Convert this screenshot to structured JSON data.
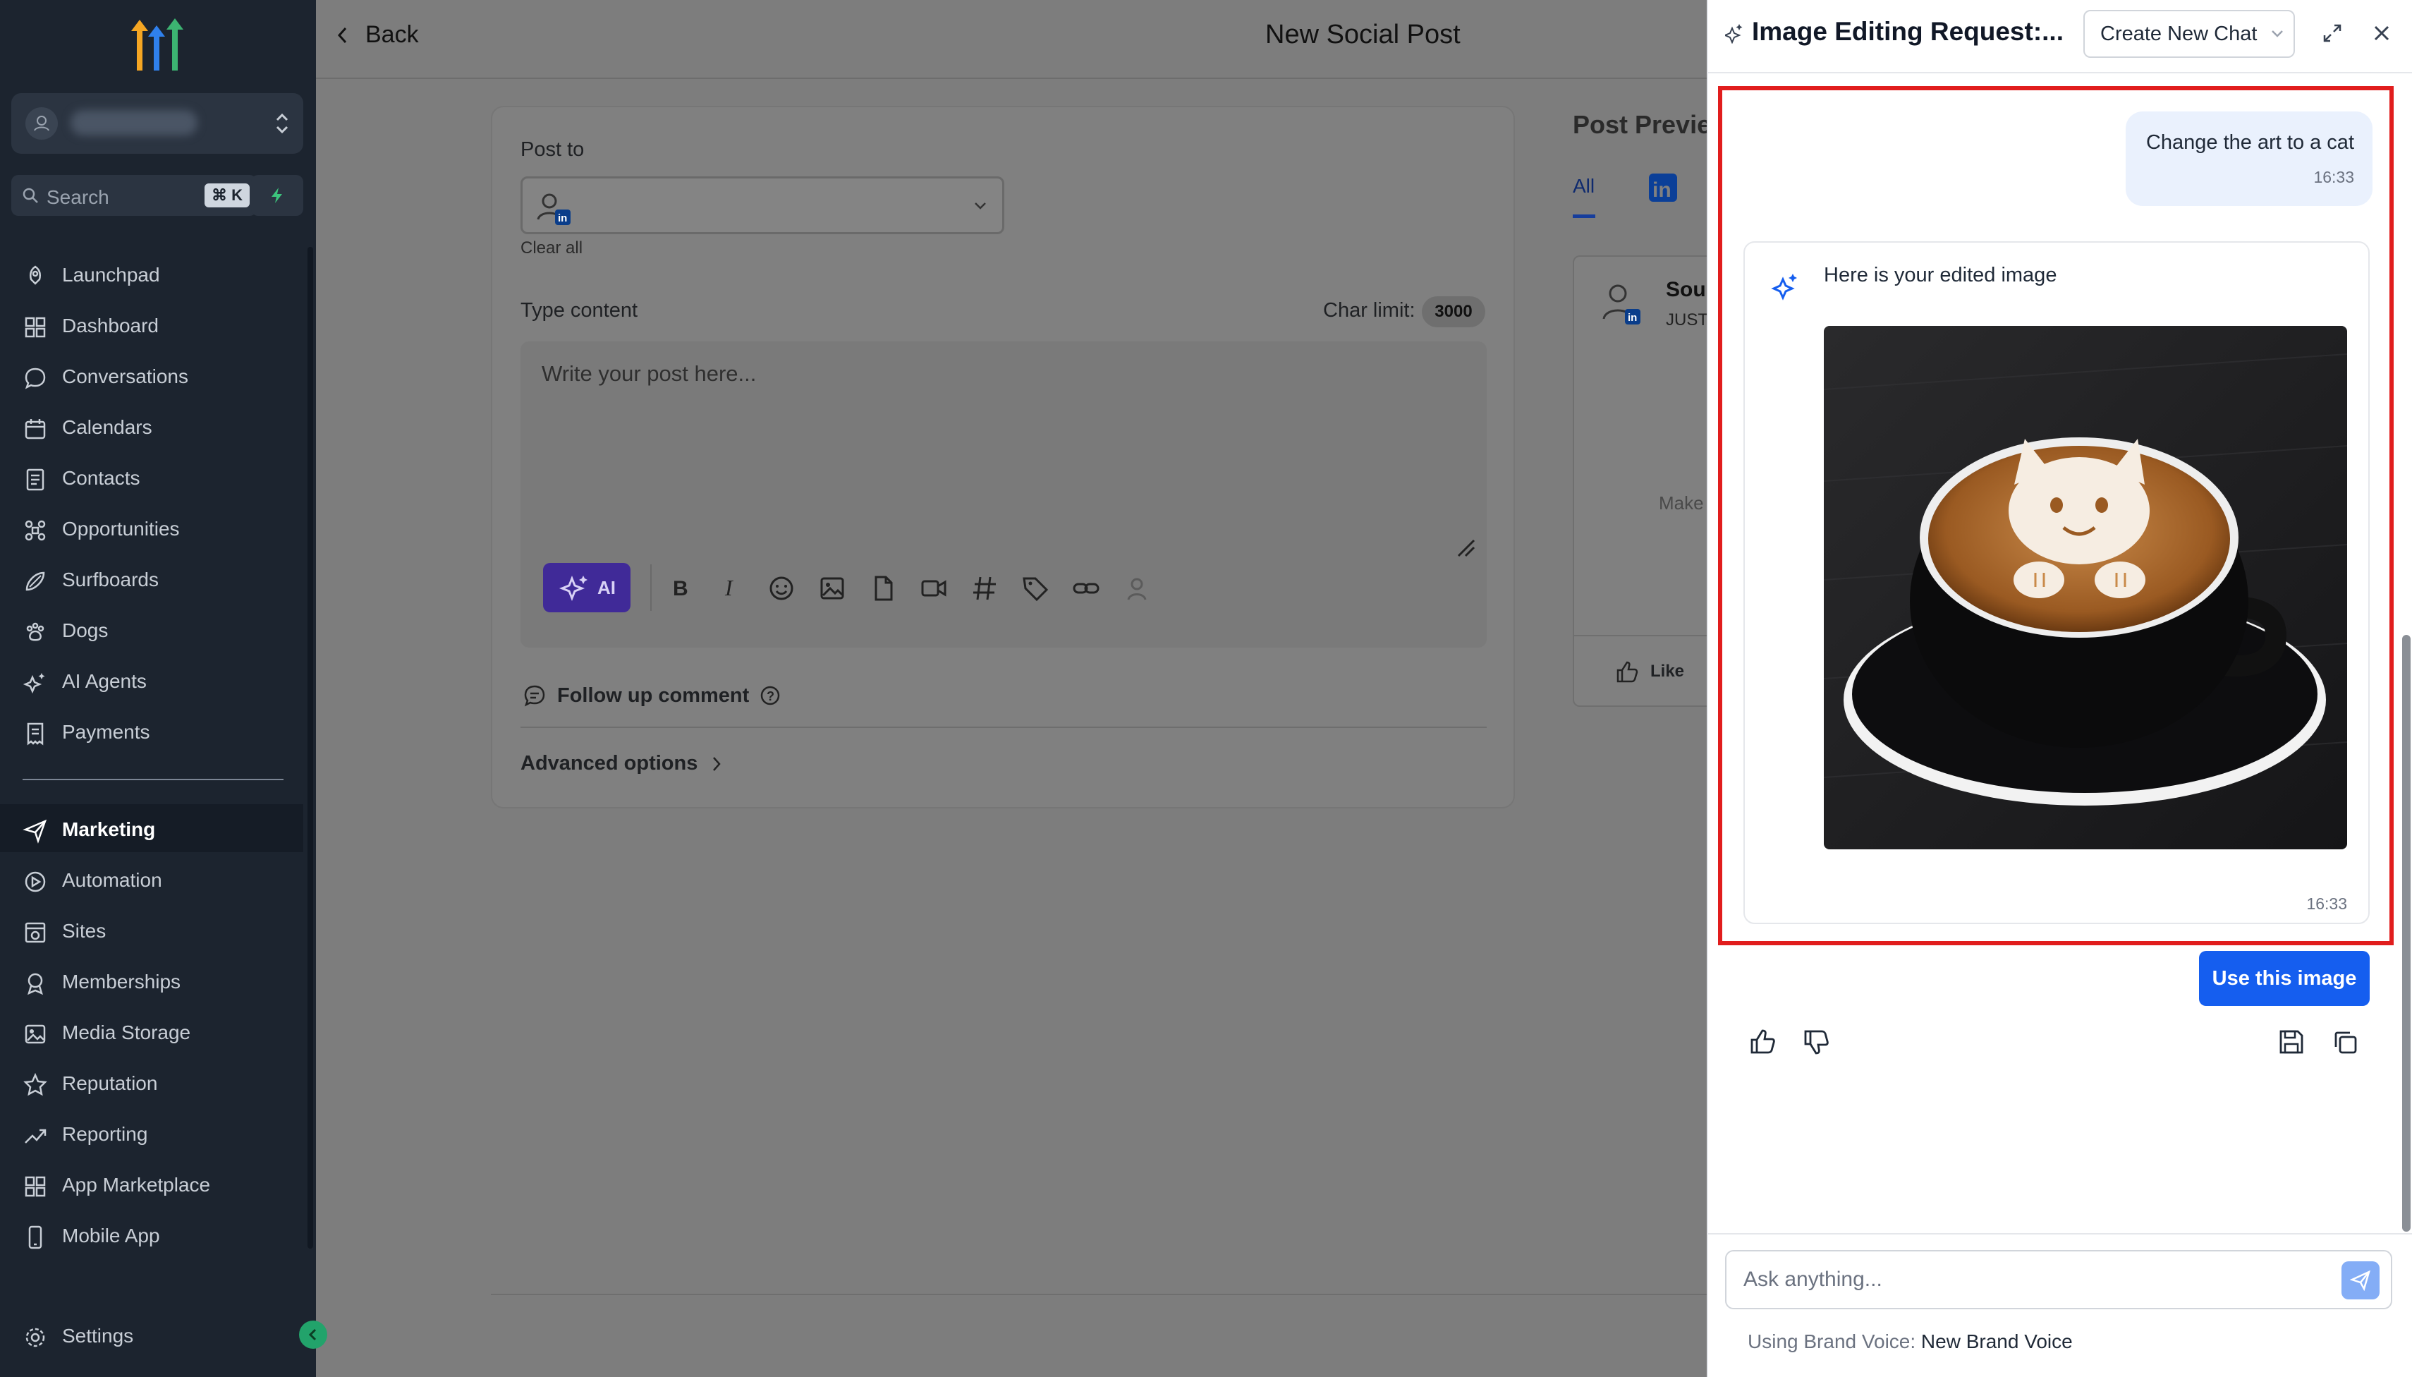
{
  "sidebar": {
    "search_placeholder": "Search",
    "search_shortcut": "⌘ K",
    "items": [
      {
        "label": "Launchpad",
        "icon": "rocket-icon"
      },
      {
        "label": "Dashboard",
        "icon": "grid-icon"
      },
      {
        "label": "Conversations",
        "icon": "chat-icon"
      },
      {
        "label": "Calendars",
        "icon": "calendar-icon"
      },
      {
        "label": "Contacts",
        "icon": "contacts-icon"
      },
      {
        "label": "Opportunities",
        "icon": "funnel-icon"
      },
      {
        "label": "Surfboards",
        "icon": "surfboard-icon"
      },
      {
        "label": "Dogs",
        "icon": "paw-icon"
      },
      {
        "label": "AI Agents",
        "icon": "sparkle-icon"
      },
      {
        "label": "Payments",
        "icon": "receipt-icon"
      }
    ],
    "items2": [
      {
        "label": "Marketing",
        "icon": "send-icon"
      },
      {
        "label": "Automation",
        "icon": "automation-icon"
      },
      {
        "label": "Sites",
        "icon": "sites-icon"
      },
      {
        "label": "Memberships",
        "icon": "medal-icon"
      },
      {
        "label": "Media Storage",
        "icon": "image-icon"
      },
      {
        "label": "Reputation",
        "icon": "star-icon"
      },
      {
        "label": "Reporting",
        "icon": "trend-icon"
      },
      {
        "label": "App Marketplace",
        "icon": "apps-icon"
      },
      {
        "label": "Mobile App",
        "icon": "mobile-icon"
      }
    ],
    "settings_label": "Settings",
    "active": "Marketing"
  },
  "topbar": {
    "back_label": "Back",
    "title": "New Social Post"
  },
  "editor": {
    "post_to_label": "Post to",
    "clear_all": "Clear all",
    "type_content_label": "Type content",
    "char_limit_label": "Char limit:",
    "char_limit_value": "3000",
    "placeholder": "Write your post here...",
    "ai_label": "AI",
    "follow_up_label": "Follow up comment",
    "advanced_label": "Advanced options"
  },
  "preview": {
    "title": "Post Preview",
    "tab_all": "All",
    "name_partial": "Sou",
    "sub_partial": "JUST",
    "make_partial": "Make",
    "like_label": "Like"
  },
  "chat": {
    "title": "Image Editing Request:...",
    "create_new_chat": "Create New Chat",
    "user_message": "Change the art to a cat",
    "user_time": "16:33",
    "bot_message": "Here is your edited image",
    "bot_time": "16:33",
    "use_image_label": "Use this image",
    "ask_placeholder": "Ask anything...",
    "brand_voice_label": "Using Brand Voice:",
    "brand_voice_value": "New Brand Voice"
  },
  "colors": {
    "sidebar_bg": "#1c242f",
    "accent_blue": "#155eef",
    "ai_purple": "#402a98",
    "highlight_red": "#e11d1d",
    "user_bubble": "#eaf1fd"
  }
}
